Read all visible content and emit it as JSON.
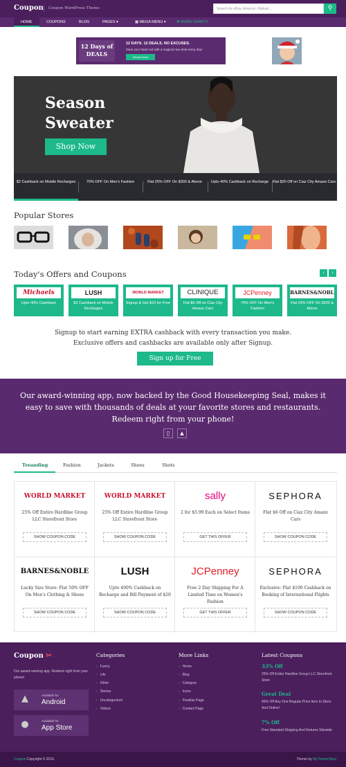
{
  "header": {
    "logo": "Coupon",
    "tagline": "Coupon WordPress Theme",
    "search_placeholder": "Search for eBay, Amazon, Flipkart...",
    "search_icon": "search-icon"
  },
  "nav": {
    "items": [
      "HOME",
      "COUPONS",
      "BLOG",
      "PAGES ▾",
      "▦ MEGA MENU ▾",
      "✚ MORE DEMO'S"
    ]
  },
  "ad": {
    "badge": "12 Days of DEALS",
    "headline": "12 DAYS. 12 DEALS. NO EXCUSES.",
    "sub": "Save your heart out with a magical new deal every day!",
    "button": "Reveal Deal"
  },
  "hero": {
    "title": "Season Sweater",
    "button": "Shop Now",
    "cells": [
      "$2 Cashback on Mobile Recharges",
      "70% OFF On Men's Fashion",
      "Flat 25% OFF On $300 & Above",
      "Upto 40% Cashback on Recharge",
      "Flat $20 Off on Ciaz City Amaze Cars"
    ]
  },
  "popular": {
    "title": "Popular Stores"
  },
  "offers": {
    "title": "Today's Offers and Coupons",
    "prev": "‹",
    "next": "›",
    "items": [
      {
        "logo": "Michaels",
        "text": "Upto 40% Cashback"
      },
      {
        "logo": "LUSH",
        "text": "$2 Cashback on Mobile Recharges"
      },
      {
        "logo": "WORLD MARKET",
        "text": "Signup & Get $10 for Free"
      },
      {
        "logo": "CLINIQUE",
        "text": "Flat $6 Off on Ciaz City Amaze Cars"
      },
      {
        "logo": "JCPenney",
        "text": "70% OFF On Men's Fashion"
      },
      {
        "logo": "BARNES&NOBLE",
        "text": "Flat 25% OFF On $300 & Above"
      }
    ]
  },
  "signup": {
    "line1": "Signup to start earning EXTRA cashback with every transaction you make.",
    "line2": "Exclusive offers and cashbacks are available only after Signup.",
    "button": "Sign up for Free"
  },
  "app": {
    "text": "Our award-winning app, now backed by the Good Housekeeping Seal, makes it easy to save with thousands of deals at your favorite stores and restaurants. Redeem right from your phone!"
  },
  "tabs": [
    "Treanding",
    "Fashion",
    "Jackets",
    "Shoes",
    "Shots"
  ],
  "cards": [
    {
      "logo": "WORLD MARKET",
      "text": "25% Off Entire Hardline Group LLC Storefront Store",
      "button": "SHOW COUPON CODE",
      "color": "#c8102e"
    },
    {
      "logo": "WORLD MARKET",
      "text": "25% Off Entire Hardline Group LLC Storefront Store",
      "button": "SHOW COUPON CODE",
      "color": "#c8102e"
    },
    {
      "logo": "sally",
      "text": "2 for $5.99 Each on Select Items",
      "button": "GET THIS OFFER",
      "color": "#e6007e"
    },
    {
      "logo": "SEPHORA",
      "text": "Flat $6 Off on Ciaz City Amaze Cars",
      "button": "SHOW COUPON CODE",
      "color": "#111111"
    },
    {
      "logo": "BARNES&NOBLE",
      "text": "Lucky Size Store: Flat 50% OFF On Men's Clothing & Shoes",
      "button": "SHOW COUPON CODE",
      "color": "#111111"
    },
    {
      "logo": "LUSH",
      "text": "Upto 400% Cashback on Recharge and Bill Payment of $20",
      "button": "SHOW COUPON CODE",
      "color": "#111111"
    },
    {
      "logo": "JCPenney",
      "text": "Free 2 Day Shipping For A Limited Time on Women's Fashion",
      "button": "GET THIS OFFER",
      "color": "#e41e26"
    },
    {
      "logo": "SEPHORA",
      "text": "Exclusive: Flat $100 Cashback on Booking of International Flights",
      "button": "SHOW COUPON CODE",
      "color": "#111111"
    }
  ],
  "footer": {
    "logo": "Coupon",
    "about": "Our award-winning app. Redeem right from your phone!",
    "android_small": "Available for",
    "android_big": "Android",
    "ios_small": "Available for",
    "ios_big": "App Store",
    "categories_title": "Categories",
    "categories": [
      "Funny",
      "Life",
      "Other",
      "Stories",
      "Uncategorized",
      "Videos"
    ],
    "more_title": "More Links",
    "more": [
      "Home",
      "Blog",
      "Category",
      "Icons",
      "Parallax Page",
      "Contact Page"
    ],
    "latest_title": "Latest Coupons",
    "latest": [
      {
        "head": "33% Off",
        "text": "25% Off Entire Hardline Group LLC Storefront Store"
      },
      {
        "head": "Great Deal",
        "text": "40% Off Any One Regular Price Item In-Store And Online!"
      },
      {
        "head": "7% Off",
        "text": "Free Standard Shipping And Returns Sitewide"
      }
    ]
  },
  "bottom": {
    "brand": "Coupon",
    "copyright": " Copyright © 2016.",
    "theme_prefix": "Theme by ",
    "theme_by": "MyThemeShop"
  },
  "colors": {
    "purple": "#5a2a6e",
    "dark_purple": "#4a1f5c",
    "green": "#1db98a"
  }
}
